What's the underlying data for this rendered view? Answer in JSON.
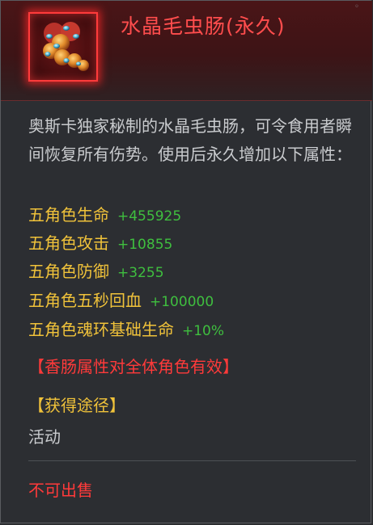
{
  "item": {
    "title": "水晶毛虫肠(永久)",
    "icon": "crystal-caterpillar-sausage-icon",
    "description": "奥斯卡独家秘制的水晶毛虫肠，可令食用者瞬间恢复所有伤势。使用后永久增加以下属性：",
    "stats": [
      {
        "name": "五角色生命",
        "value": "+455925"
      },
      {
        "name": "五角色攻击",
        "value": "+10855"
      },
      {
        "name": "五角色防御",
        "value": "+3255"
      },
      {
        "name": "五角色五秒回血",
        "value": "+100000"
      },
      {
        "name": "五角色魂环基础生命",
        "value": "+10%"
      }
    ],
    "effect_note": "【香肠属性对全体角色有效】",
    "source_heading": "【获得途径】",
    "source_value": "活动",
    "sell_status": "不可出售"
  },
  "colors": {
    "title": "#ff4d4d",
    "stat_name": "#f0c23a",
    "stat_value": "#3fbf3f",
    "warning": "#ff3a3a",
    "body_text": "#c9cbce"
  }
}
